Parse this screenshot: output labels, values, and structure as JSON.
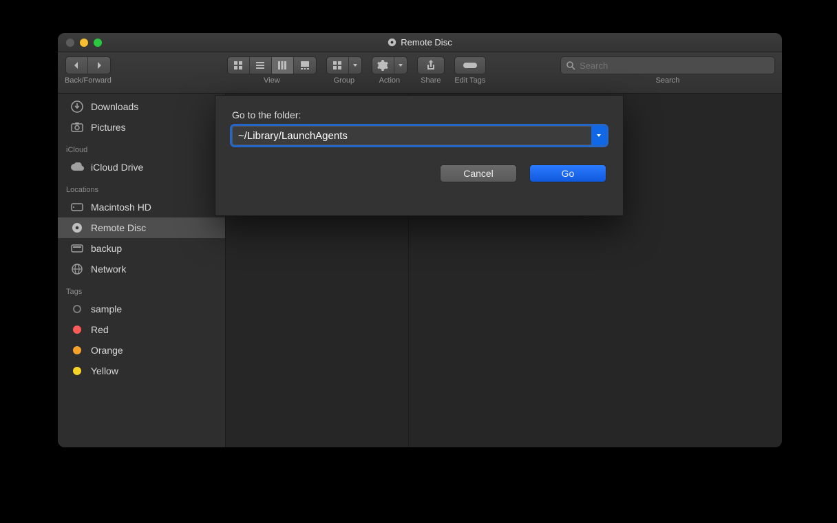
{
  "window": {
    "title": "Remote Disc"
  },
  "toolbar": {
    "back_forward_label": "Back/Forward",
    "view_label": "View",
    "group_label": "Group",
    "action_label": "Action",
    "share_label": "Share",
    "edit_tags_label": "Edit Tags",
    "search_label": "Search",
    "search_placeholder": "Search",
    "search_value": ""
  },
  "sidebar": {
    "favorites": [
      {
        "label": "Downloads",
        "icon": "download-icon"
      },
      {
        "label": "Pictures",
        "icon": "camera-icon"
      }
    ],
    "icloud_label": "iCloud",
    "icloud": [
      {
        "label": "iCloud Drive",
        "icon": "cloud-icon"
      }
    ],
    "locations_label": "Locations",
    "locations": [
      {
        "label": "Macintosh HD",
        "icon": "hdd-icon",
        "selected": false
      },
      {
        "label": "Remote Disc",
        "icon": "disc-icon",
        "selected": true
      },
      {
        "label": "backup",
        "icon": "drive-icon",
        "selected": false
      },
      {
        "label": "Network",
        "icon": "globe-icon",
        "selected": false
      }
    ],
    "tags_label": "Tags",
    "tags": [
      {
        "label": "sample",
        "color": ""
      },
      {
        "label": "Red",
        "color": "#fc5b57"
      },
      {
        "label": "Orange",
        "color": "#f6a22a"
      },
      {
        "label": "Yellow",
        "color": "#f6d32a"
      }
    ]
  },
  "dialog": {
    "prompt": "Go to the folder:",
    "value": "~/Library/LaunchAgents",
    "cancel_label": "Cancel",
    "go_label": "Go"
  },
  "colors": {
    "accent": "#1068e6"
  }
}
